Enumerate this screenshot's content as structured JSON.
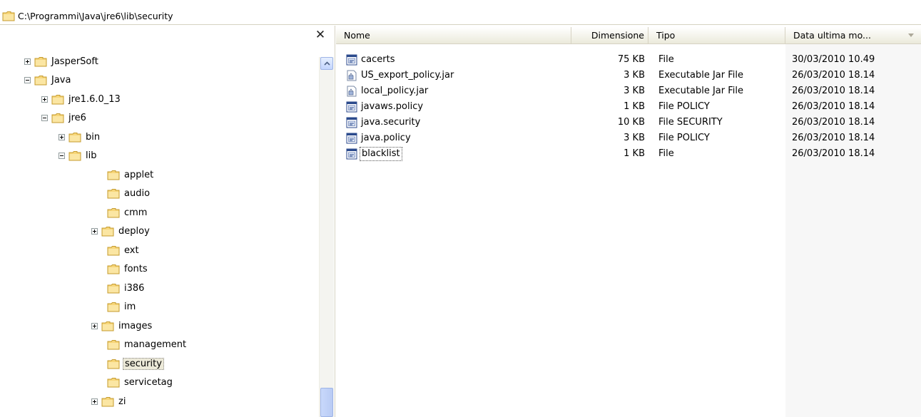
{
  "address": {
    "path": "C:\\Programmi\\Java\\jre6\\lib\\security"
  },
  "left_pane": {
    "close_glyph": "✕",
    "tree": [
      {
        "label": "JasperSoft",
        "expander": "plus",
        "level": 0
      },
      {
        "label": "Java",
        "expander": "minus",
        "level": 0
      },
      {
        "label": "jre1.6.0_13",
        "expander": "plus",
        "level": 1
      },
      {
        "label": "jre6",
        "expander": "minus",
        "level": 1
      },
      {
        "label": "bin",
        "expander": "plus",
        "level": 2
      },
      {
        "label": "lib",
        "expander": "minus",
        "level": 2
      },
      {
        "label": "applet",
        "expander": "none",
        "level": 3
      },
      {
        "label": "audio",
        "expander": "none",
        "level": 3
      },
      {
        "label": "cmm",
        "expander": "none",
        "level": 3
      },
      {
        "label": "deploy",
        "expander": "plus",
        "level": 3
      },
      {
        "label": "ext",
        "expander": "none",
        "level": 3
      },
      {
        "label": "fonts",
        "expander": "none",
        "level": 3
      },
      {
        "label": "i386",
        "expander": "none",
        "level": 3
      },
      {
        "label": "im",
        "expander": "none",
        "level": 3
      },
      {
        "label": "images",
        "expander": "plus",
        "level": 3
      },
      {
        "label": "management",
        "expander": "none",
        "level": 3
      },
      {
        "label": "security",
        "expander": "none",
        "level": 3,
        "selected": true
      },
      {
        "label": "servicetag",
        "expander": "none",
        "level": 3
      },
      {
        "label": "zi",
        "expander": "plus",
        "level": 3
      }
    ]
  },
  "file_list": {
    "columns": {
      "name": "Nome",
      "size": "Dimensione",
      "type": "Tipo",
      "date": "Data ultima mo..."
    },
    "rows": [
      {
        "name": "cacerts",
        "size": "75 KB",
        "type": "File",
        "date": "30/03/2010 10.49",
        "icon": "file-icon"
      },
      {
        "name": "US_export_policy.jar",
        "size": "3 KB",
        "type": "Executable Jar File",
        "date": "26/03/2010 18.14",
        "icon": "jar-icon"
      },
      {
        "name": "local_policy.jar",
        "size": "3 KB",
        "type": "Executable Jar File",
        "date": "26/03/2010 18.14",
        "icon": "jar-icon"
      },
      {
        "name": "javaws.policy",
        "size": "1 KB",
        "type": "File POLICY",
        "date": "26/03/2010 18.14",
        "icon": "file-icon"
      },
      {
        "name": "java.security",
        "size": "10 KB",
        "type": "File SECURITY",
        "date": "26/03/2010 18.14",
        "icon": "file-icon"
      },
      {
        "name": "java.policy",
        "size": "3 KB",
        "type": "File POLICY",
        "date": "26/03/2010 18.14",
        "icon": "file-icon"
      },
      {
        "name": "blacklist",
        "size": "1 KB",
        "type": "File",
        "date": "26/03/2010 18.14",
        "icon": "file-icon",
        "focused": true
      }
    ]
  }
}
